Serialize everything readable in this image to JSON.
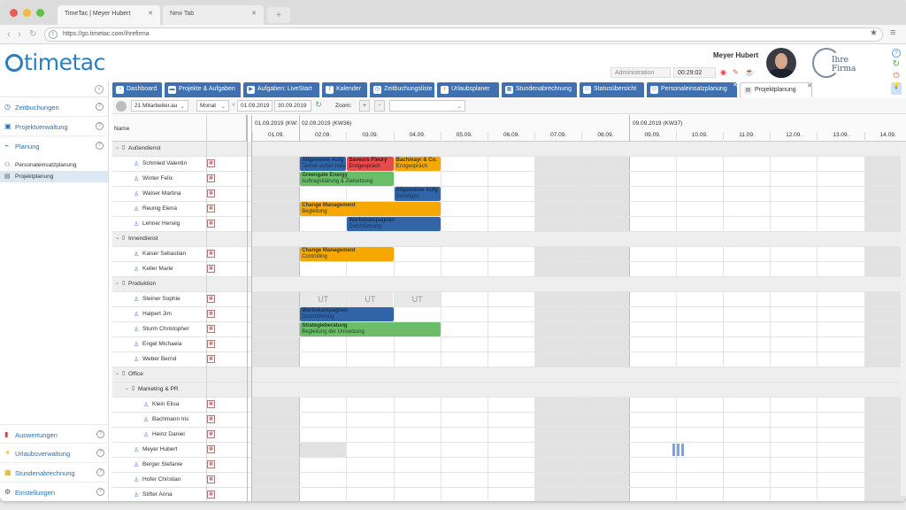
{
  "browser": {
    "tabs": [
      {
        "title": "TimeTac | Meyer Hubert"
      },
      {
        "title": "New Tab"
      }
    ],
    "url": "https://go.timetac.com/ihrefirma"
  },
  "header": {
    "logo_text": "timetac",
    "user_name": "Meyer Hubert",
    "role_select": "Administration",
    "timer": "00:29:02",
    "company_logo_text": "Ihre Firma"
  },
  "sidebar": {
    "items": [
      {
        "label": "Zeitbuchungen",
        "icon": "clock-icon"
      },
      {
        "label": "Projektverwaltung",
        "icon": "folder-icon"
      },
      {
        "label": "Planung",
        "icon": "chart-icon"
      }
    ],
    "sub_items": [
      {
        "label": "Personaleinsatzplanung"
      },
      {
        "label": "Projektplanung"
      }
    ],
    "bottom_items": [
      {
        "label": "Auswertungen",
        "icon": "bar-chart-icon"
      },
      {
        "label": "Urlaubsverwaltung",
        "icon": "sun-icon"
      },
      {
        "label": "Stundenabrechnung",
        "icon": "calculator-icon"
      },
      {
        "label": "Einstellungen",
        "icon": "gear-icon"
      }
    ]
  },
  "app_tabs": [
    {
      "label": "Dashboard"
    },
    {
      "label": "Projekte & Aufgaben"
    },
    {
      "label": "Aufgaben: LiveStart"
    },
    {
      "label": "Kalender"
    },
    {
      "label": "Zeitbuchungsliste"
    },
    {
      "label": "Urlaubsplaner"
    },
    {
      "label": "Stundenabrechnung"
    },
    {
      "label": "Statusübersicht"
    },
    {
      "label": "Personaleinsatzplanung"
    },
    {
      "label": "Projektplanung"
    }
  ],
  "toolbar": {
    "employees": "21 Mitarbeiter.au",
    "view": "Monat",
    "date_from": "01.09.2019",
    "date_to": "30.09.2019",
    "zoom_label": "Zoom:",
    "zoom_in": "+",
    "zoom_out": "-"
  },
  "grid": {
    "name_header": "Name",
    "week_labels": [
      "01.09.2019 (KW:",
      "02.09.2019 (KW36)",
      "09.09.2019 (KW37)"
    ],
    "days": [
      "01.09.",
      "02.09.",
      "03.09.",
      "04.09.",
      "05.09.",
      "06.09.",
      "07.09.",
      "08.09.",
      "09.09.",
      "10.09.",
      "11.09.",
      "12.09.",
      "13.09.",
      "14.09."
    ],
    "rows": [
      {
        "type": "group",
        "name": "Außendienst"
      },
      {
        "type": "person",
        "name": "Schmied Valentin"
      },
      {
        "type": "person",
        "name": "Winter Felix"
      },
      {
        "type": "person",
        "name": "Walser Martina"
      },
      {
        "type": "person",
        "name": "Reunig Elena"
      },
      {
        "type": "person",
        "name": "Lehner Herwig"
      },
      {
        "type": "group",
        "name": "Innendienst"
      },
      {
        "type": "person",
        "name": "Kaiser Sebastian"
      },
      {
        "type": "person",
        "name": "Keller Marie"
      },
      {
        "type": "group",
        "name": "Produktion"
      },
      {
        "type": "person",
        "name": "Steiner Sophie"
      },
      {
        "type": "person",
        "name": "Halpert Jim"
      },
      {
        "type": "person",
        "name": "Sturm Christopher"
      },
      {
        "type": "person",
        "name": "Engel Michaela"
      },
      {
        "type": "person",
        "name": "Weber Bernd"
      },
      {
        "type": "group",
        "name": "Office"
      },
      {
        "type": "subgroup",
        "name": "Marketing & PR"
      },
      {
        "type": "subperson",
        "name": "Klein Elisa"
      },
      {
        "type": "subperson",
        "name": "Bachmann Iris"
      },
      {
        "type": "subperson",
        "name": "Heinz Daniel"
      },
      {
        "type": "person",
        "name": "Meyer Hubert"
      },
      {
        "type": "person",
        "name": "Berger Stefanie"
      },
      {
        "type": "person",
        "name": "Hofer Christian"
      },
      {
        "type": "person",
        "name": "Stifter Anna"
      }
    ],
    "bars": [
      {
        "row": 1,
        "start": 1,
        "days": 1,
        "color": "blue",
        "title": "Allgemeine Aufg",
        "sub": "Termin außer Haus"
      },
      {
        "row": 1,
        "start": 2,
        "days": 1,
        "color": "red",
        "title": "Saveurs Fleury",
        "sub": "Erstgespräch"
      },
      {
        "row": 1,
        "start": 3,
        "days": 1,
        "color": "orange",
        "title": "Bachmayr & Co.",
        "sub": "Erstgespräch"
      },
      {
        "row": 2,
        "start": 1,
        "days": 2,
        "color": "green",
        "title": "Greengate Energy",
        "sub": "Auftragsklärung & Zielsetzung"
      },
      {
        "row": 3,
        "start": 3,
        "days": 1,
        "color": "blue",
        "title": "Allgemeine Aufg",
        "sub": "Sonstiges"
      },
      {
        "row": 4,
        "start": 1,
        "days": 3,
        "color": "orange",
        "title": "Change Management",
        "sub": "Begleitung"
      },
      {
        "row": 5,
        "start": 2,
        "days": 2,
        "color": "blue",
        "title": "Werbekampagnen",
        "sub": "Durchführung"
      },
      {
        "row": 7,
        "start": 1,
        "days": 2,
        "color": "orange",
        "title": "Change Management",
        "sub": "Controlling"
      },
      {
        "row": 11,
        "start": 1,
        "days": 2,
        "color": "blue",
        "title": "Werbekampagnen",
        "sub": "Durchführung"
      },
      {
        "row": 12,
        "start": 1,
        "days": 3,
        "color": "green",
        "title": "Strategieberatung",
        "sub": "Begleitung der Umsetzung"
      }
    ],
    "ut_label": "UT",
    "ut_row": 10,
    "ut_days": [
      1,
      2,
      3
    ]
  }
}
